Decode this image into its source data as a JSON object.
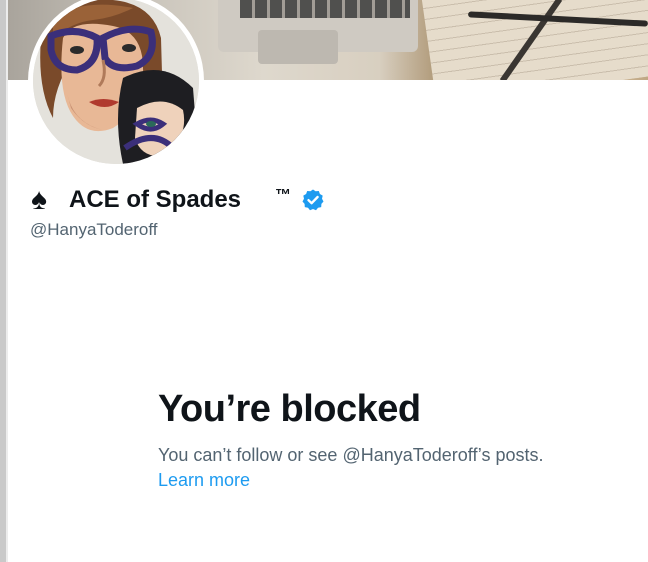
{
  "profile": {
    "display_name": "ACE of Spades",
    "name_prefix_symbol": "♠",
    "trademark": "™",
    "verified": true,
    "handle": "@HanyaToderoff"
  },
  "blocked_notice": {
    "title": "You’re blocked",
    "description": "You can’t follow or see @HanyaToderoff’s posts.",
    "learn_more": "Learn more"
  },
  "colors": {
    "text_primary": "#0f1419",
    "text_secondary": "#536471",
    "link": "#1d9bf0",
    "verified_badge": "#1d9bf0"
  },
  "icons": {
    "spade": "spade-icon",
    "verified": "verified-badge-icon"
  }
}
